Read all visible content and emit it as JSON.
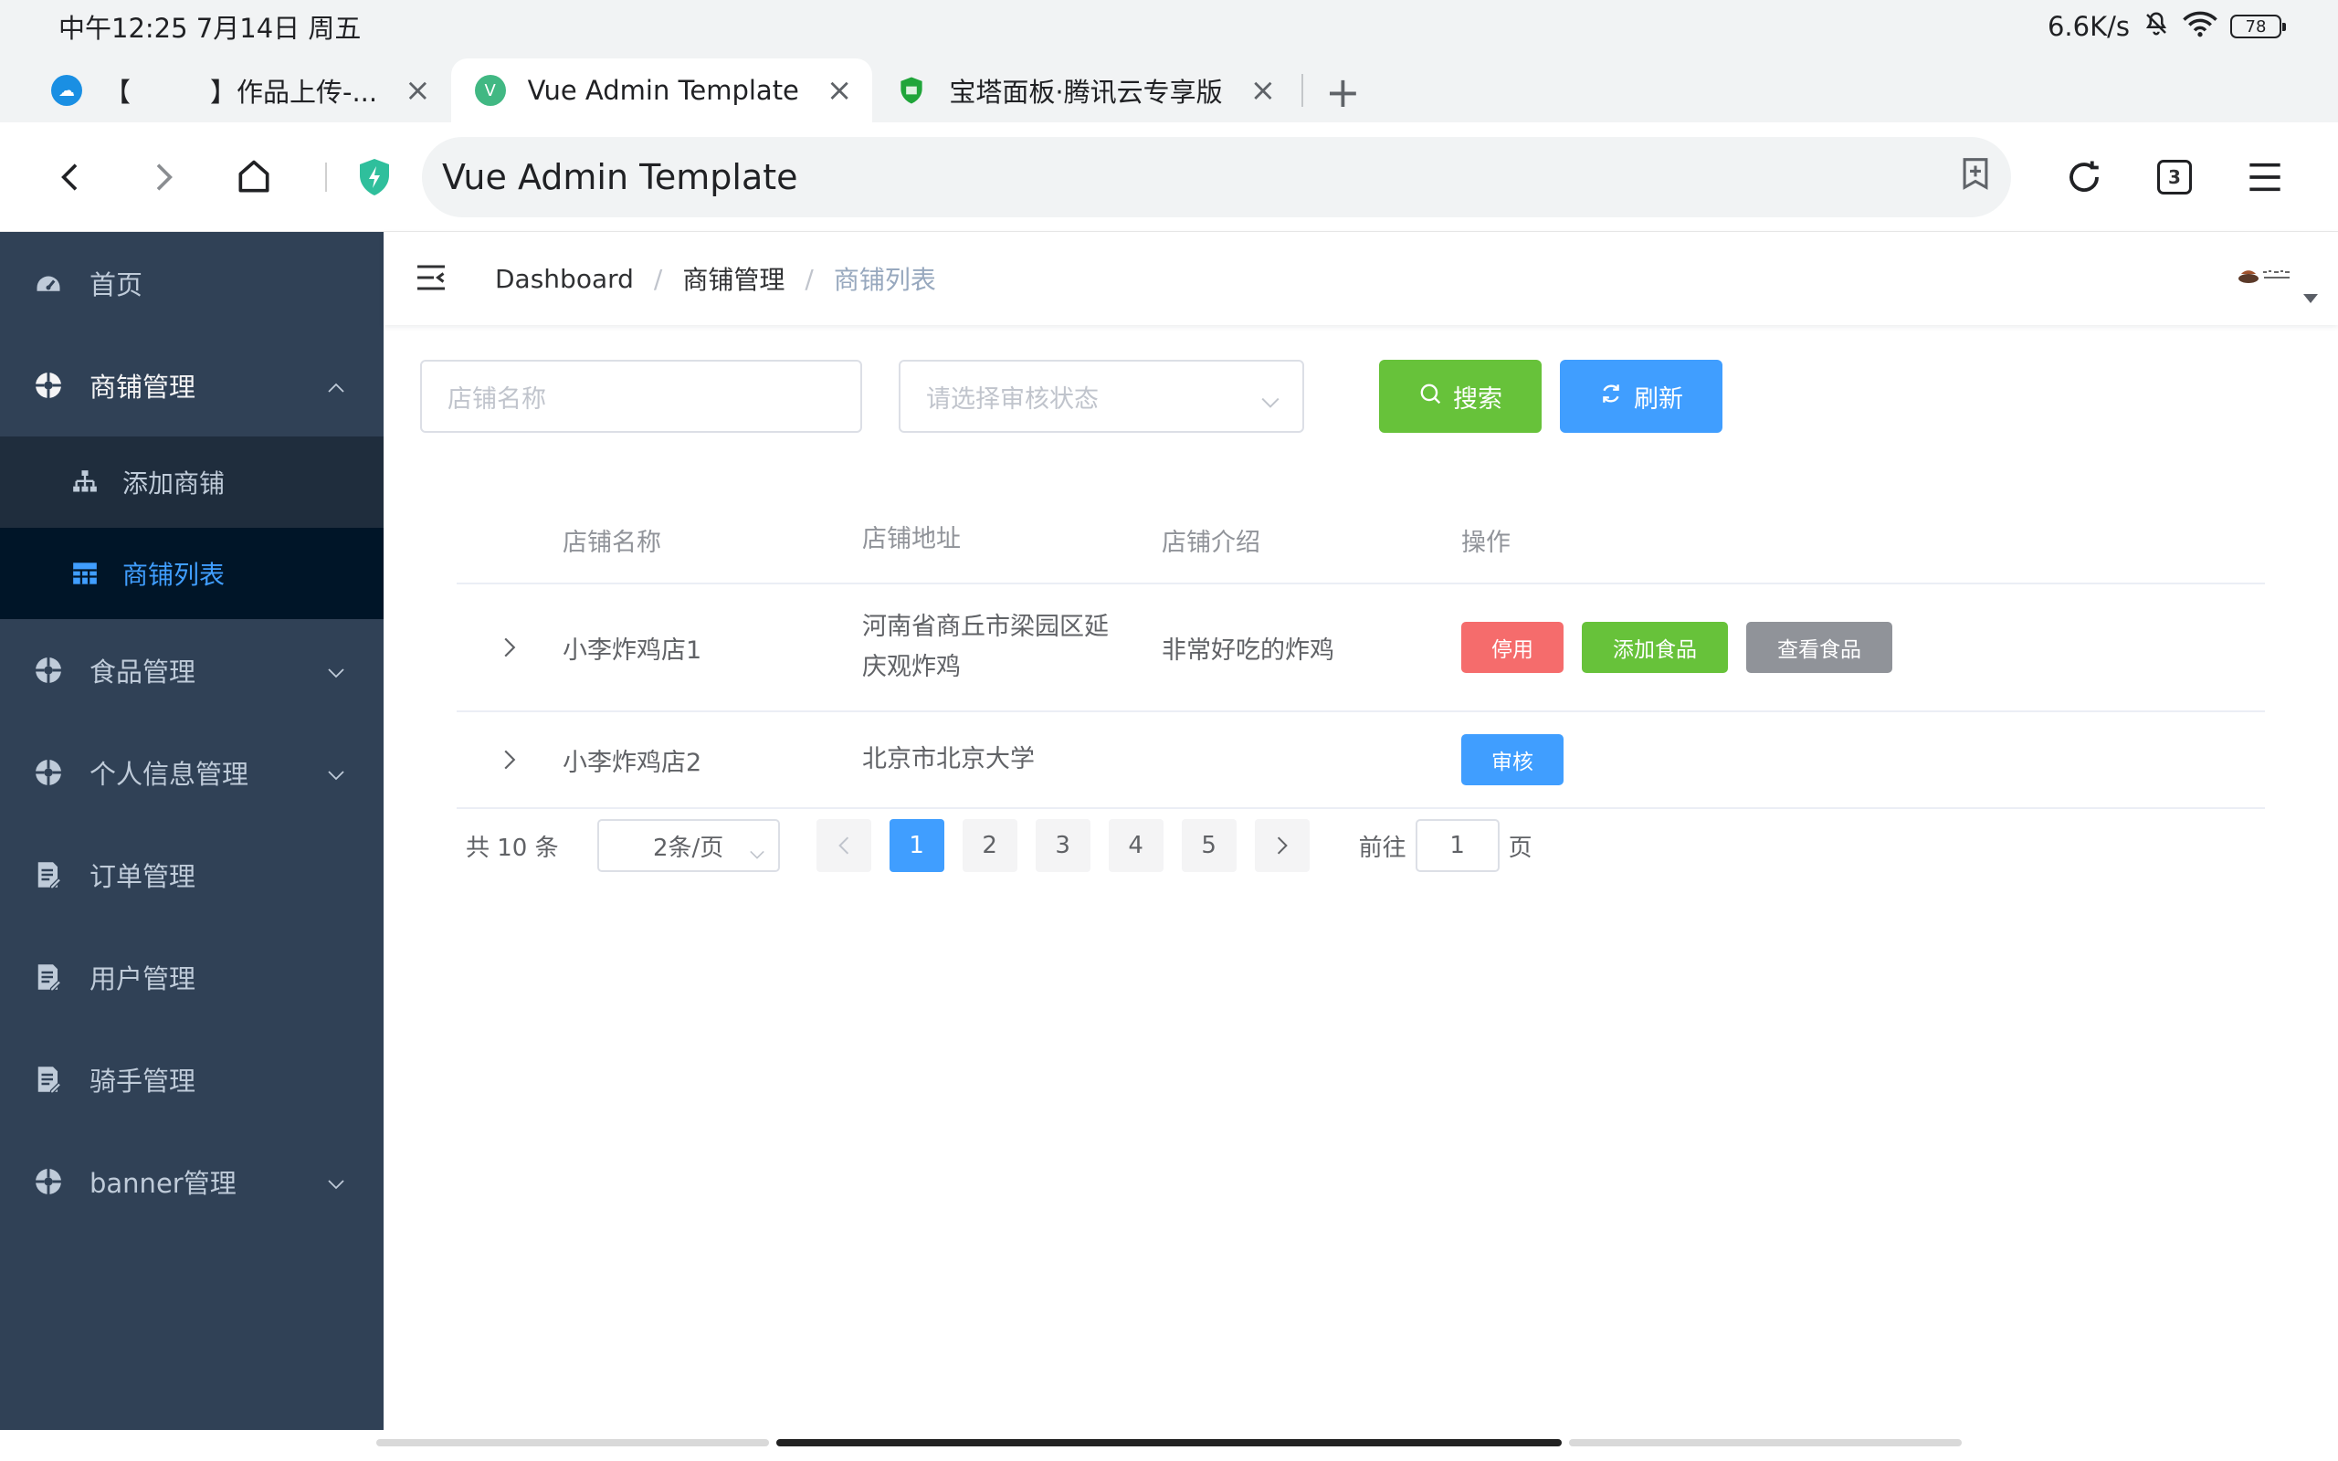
{
  "status_bar": {
    "time": "中午12:25 7月14日 周五",
    "net_speed": "6.6K/s",
    "battery": "78"
  },
  "browser": {
    "tabs": [
      {
        "title": "【　　　】作品上传-...",
        "favicon": "cloud-app-icon",
        "color": "#1a8fe3"
      },
      {
        "title": "Vue Admin Template",
        "favicon": "vue-icon",
        "color": "#41b883"
      },
      {
        "title": "宝塔面板·腾讯云专享版",
        "favicon": "shield-icon",
        "color": "#20a53a"
      }
    ],
    "url_text": "Vue Admin Template",
    "tab_count": "3"
  },
  "sidebar": {
    "items": [
      {
        "label": "首页",
        "icon": "dashboard-icon"
      },
      {
        "label": "商铺管理",
        "icon": "component-icon",
        "expanded": true
      },
      {
        "label": "食品管理",
        "icon": "component-icon"
      },
      {
        "label": "个人信息管理",
        "icon": "component-icon"
      },
      {
        "label": "订单管理",
        "icon": "form-icon"
      },
      {
        "label": "用户管理",
        "icon": "form-icon"
      },
      {
        "label": "骑手管理",
        "icon": "form-icon"
      },
      {
        "label": "banner管理",
        "icon": "component-icon"
      }
    ],
    "shop_sub": [
      {
        "label": "添加商铺",
        "icon": "tree-icon"
      },
      {
        "label": "商铺列表",
        "icon": "table-icon",
        "active": true
      }
    ]
  },
  "breadcrumb": [
    "Dashboard",
    "商铺管理",
    "商铺列表"
  ],
  "filters": {
    "name_placeholder": "店铺名称",
    "status_placeholder": "请选择审核状态",
    "search_label": "搜索",
    "refresh_label": "刷新"
  },
  "table": {
    "headers": [
      "店铺名称",
      "店铺地址",
      "店铺介绍",
      "操作"
    ],
    "rows": [
      {
        "name": "小李炸鸡店1",
        "address": "河南省商丘市梁园区延庆观炸鸡",
        "intro": "非常好吃的炸鸡",
        "actions": [
          "停用",
          "添加食品",
          "查看食品"
        ]
      },
      {
        "name": "小李炸鸡店2",
        "address": "北京市北京大学",
        "intro": "",
        "actions": [
          "审核"
        ]
      }
    ]
  },
  "pagination": {
    "total": "共 10 条",
    "page_size": "2条/页",
    "pages": [
      "1",
      "2",
      "3",
      "4",
      "5"
    ],
    "current": "1",
    "goto_prefix": "前往",
    "goto_value": "1",
    "goto_suffix": "页"
  },
  "colors": {
    "sidebar_bg": "#304156",
    "sidebar_sub_bg": "#1f2d3d",
    "sidebar_active_bg": "#001528",
    "primary": "#409eff",
    "success": "#67c23a",
    "danger": "#f56c6c",
    "info": "#909399"
  }
}
